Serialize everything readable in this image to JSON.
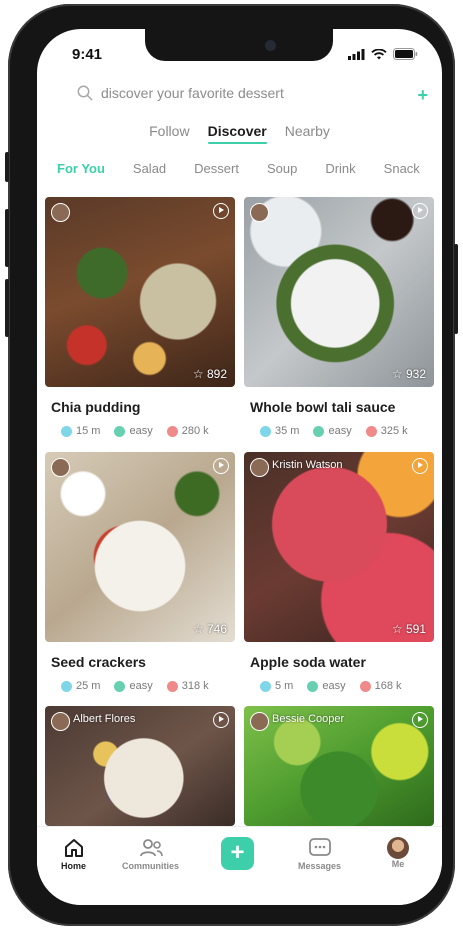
{
  "status": {
    "time": "9:41"
  },
  "search": {
    "placeholder": "discover your favorite dessert"
  },
  "top_tabs": [
    {
      "label": "Follow"
    },
    {
      "label": "Discover",
      "active": true
    },
    {
      "label": "Nearby"
    }
  ],
  "categories": [
    {
      "label": "For You",
      "active": true
    },
    {
      "label": "Salad"
    },
    {
      "label": "Dessert"
    },
    {
      "label": "Soup"
    },
    {
      "label": "Drink"
    },
    {
      "label": "Snack"
    }
  ],
  "cards": [
    {
      "title": "Chia pudding",
      "likes": "892",
      "time": "15 m",
      "level": "easy",
      "calories": "280 k"
    },
    {
      "title": "Whole bowl tali sauce",
      "likes": "932",
      "time": "35 m",
      "level": "easy",
      "calories": "325 k"
    },
    {
      "title": "Seed crackers",
      "likes": "746",
      "time": "25 m",
      "level": "easy",
      "calories": "318 k"
    },
    {
      "title": "Apple soda water",
      "author": "Kristin Watson",
      "likes": "591",
      "time": "5 m",
      "level": "easy",
      "calories": "168 k"
    },
    {
      "author": "Albert Flores"
    },
    {
      "author": "Bessie Cooper"
    }
  ],
  "tabbar": {
    "home": "Home",
    "communities": "Communities",
    "messages": "Messages",
    "me": "Me"
  },
  "colors": {
    "accent": "#3ccfa9",
    "time_dot": "#7fd6e8",
    "level_dot": "#66d0b0",
    "cal_dot": "#f08a8a"
  }
}
